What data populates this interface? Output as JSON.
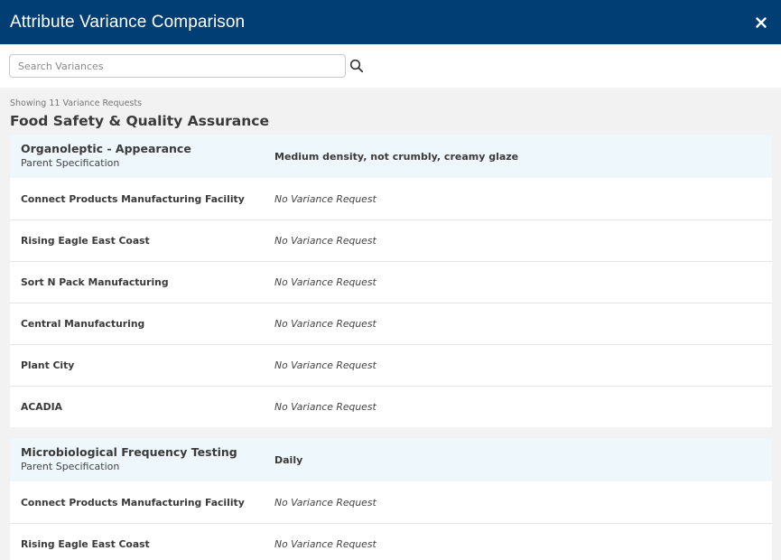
{
  "header": {
    "title": "Attribute Variance Comparison",
    "close_icon": "close-icon"
  },
  "search": {
    "placeholder": "Search Variances",
    "value": "",
    "icon": "search-icon"
  },
  "summary": {
    "showing_text": "Showing 11 Variance Requests",
    "section_title": "Food Safety & Quality Assurance"
  },
  "attributes": [
    {
      "name": "Organoleptic - Appearance",
      "sublabel": "Parent Specification",
      "spec": "Medium density, not crumbly, creamy glaze",
      "rows": [
        {
          "facility": "Connect Products Manufacturing Facility",
          "variance": "No Variance Request"
        },
        {
          "facility": "Rising Eagle East Coast",
          "variance": "No Variance Request"
        },
        {
          "facility": "Sort N Pack Manufacturing",
          "variance": "No Variance Request"
        },
        {
          "facility": "Central Manufacturing",
          "variance": "No Variance Request"
        },
        {
          "facility": "Plant City",
          "variance": "No Variance Request"
        },
        {
          "facility": "ACADIA",
          "variance": "No Variance Request"
        }
      ]
    },
    {
      "name": "Microbiological Frequency Testing",
      "sublabel": "Parent Specification",
      "spec": "Daily",
      "rows": [
        {
          "facility": "Connect Products Manufacturing Facility",
          "variance": "No Variance Request"
        },
        {
          "facility": "Rising Eagle East Coast",
          "variance": "No Variance Request"
        }
      ]
    }
  ]
}
